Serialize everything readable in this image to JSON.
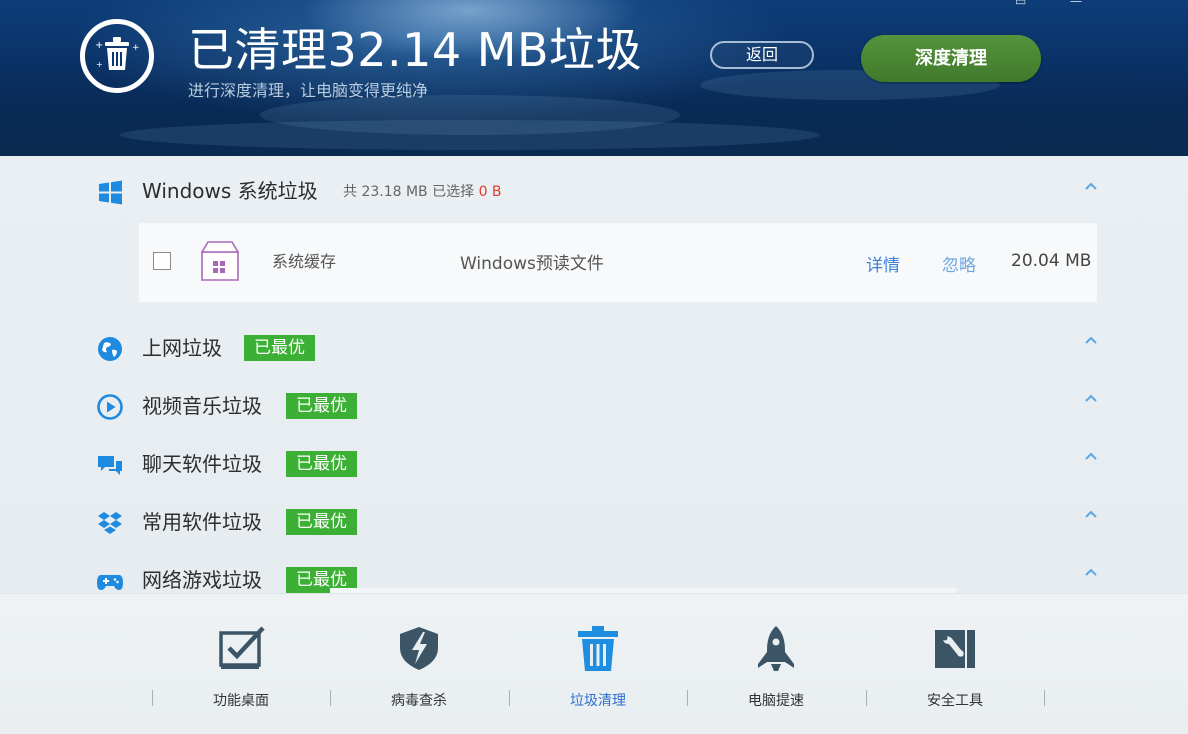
{
  "header": {
    "title": "已清理32.14 MB垃圾",
    "subtitle": "进行深度清理，让电脑变得更纯净",
    "back_label": "返回",
    "deep_clean_label": "深度清理",
    "window_controls": [
      "▭",
      "—"
    ]
  },
  "categories": [
    {
      "title": "Windows 系统垃圾",
      "meta_prefix": "共 23.18 MB 已选择",
      "meta_selected": "0 B",
      "icon": "windows-icon",
      "items": [
        {
          "name": "系统缓存",
          "desc": "Windows预读文件",
          "detail": "详情",
          "ignore": "忽略",
          "size": "20.04 MB"
        }
      ]
    },
    {
      "title": "上网垃圾",
      "badge": "已最优",
      "icon": "globe-icon"
    },
    {
      "title": "视频音乐垃圾",
      "badge": "已最优",
      "icon": "play-icon"
    },
    {
      "title": "聊天软件垃圾",
      "badge": "已最优",
      "icon": "chat-icon"
    },
    {
      "title": "常用软件垃圾",
      "badge": "已最优",
      "icon": "dropbox-icon"
    },
    {
      "title": "网络游戏垃圾",
      "badge": "已最优",
      "icon": "gamepad-icon"
    }
  ],
  "nav": [
    {
      "label": "功能桌面",
      "icon": "checkbox-icon"
    },
    {
      "label": "病毒查杀",
      "icon": "shield-icon"
    },
    {
      "label": "垃圾清理",
      "icon": "trash-icon",
      "active": true
    },
    {
      "label": "电脑提速",
      "icon": "rocket-icon"
    },
    {
      "label": "安全工具",
      "icon": "toolbox-icon"
    }
  ],
  "colors": {
    "accent_green": "#3cb034",
    "link_blue": "#3a82d8",
    "selected_red": "#e53b2a",
    "header_navy": "#0a3266"
  }
}
